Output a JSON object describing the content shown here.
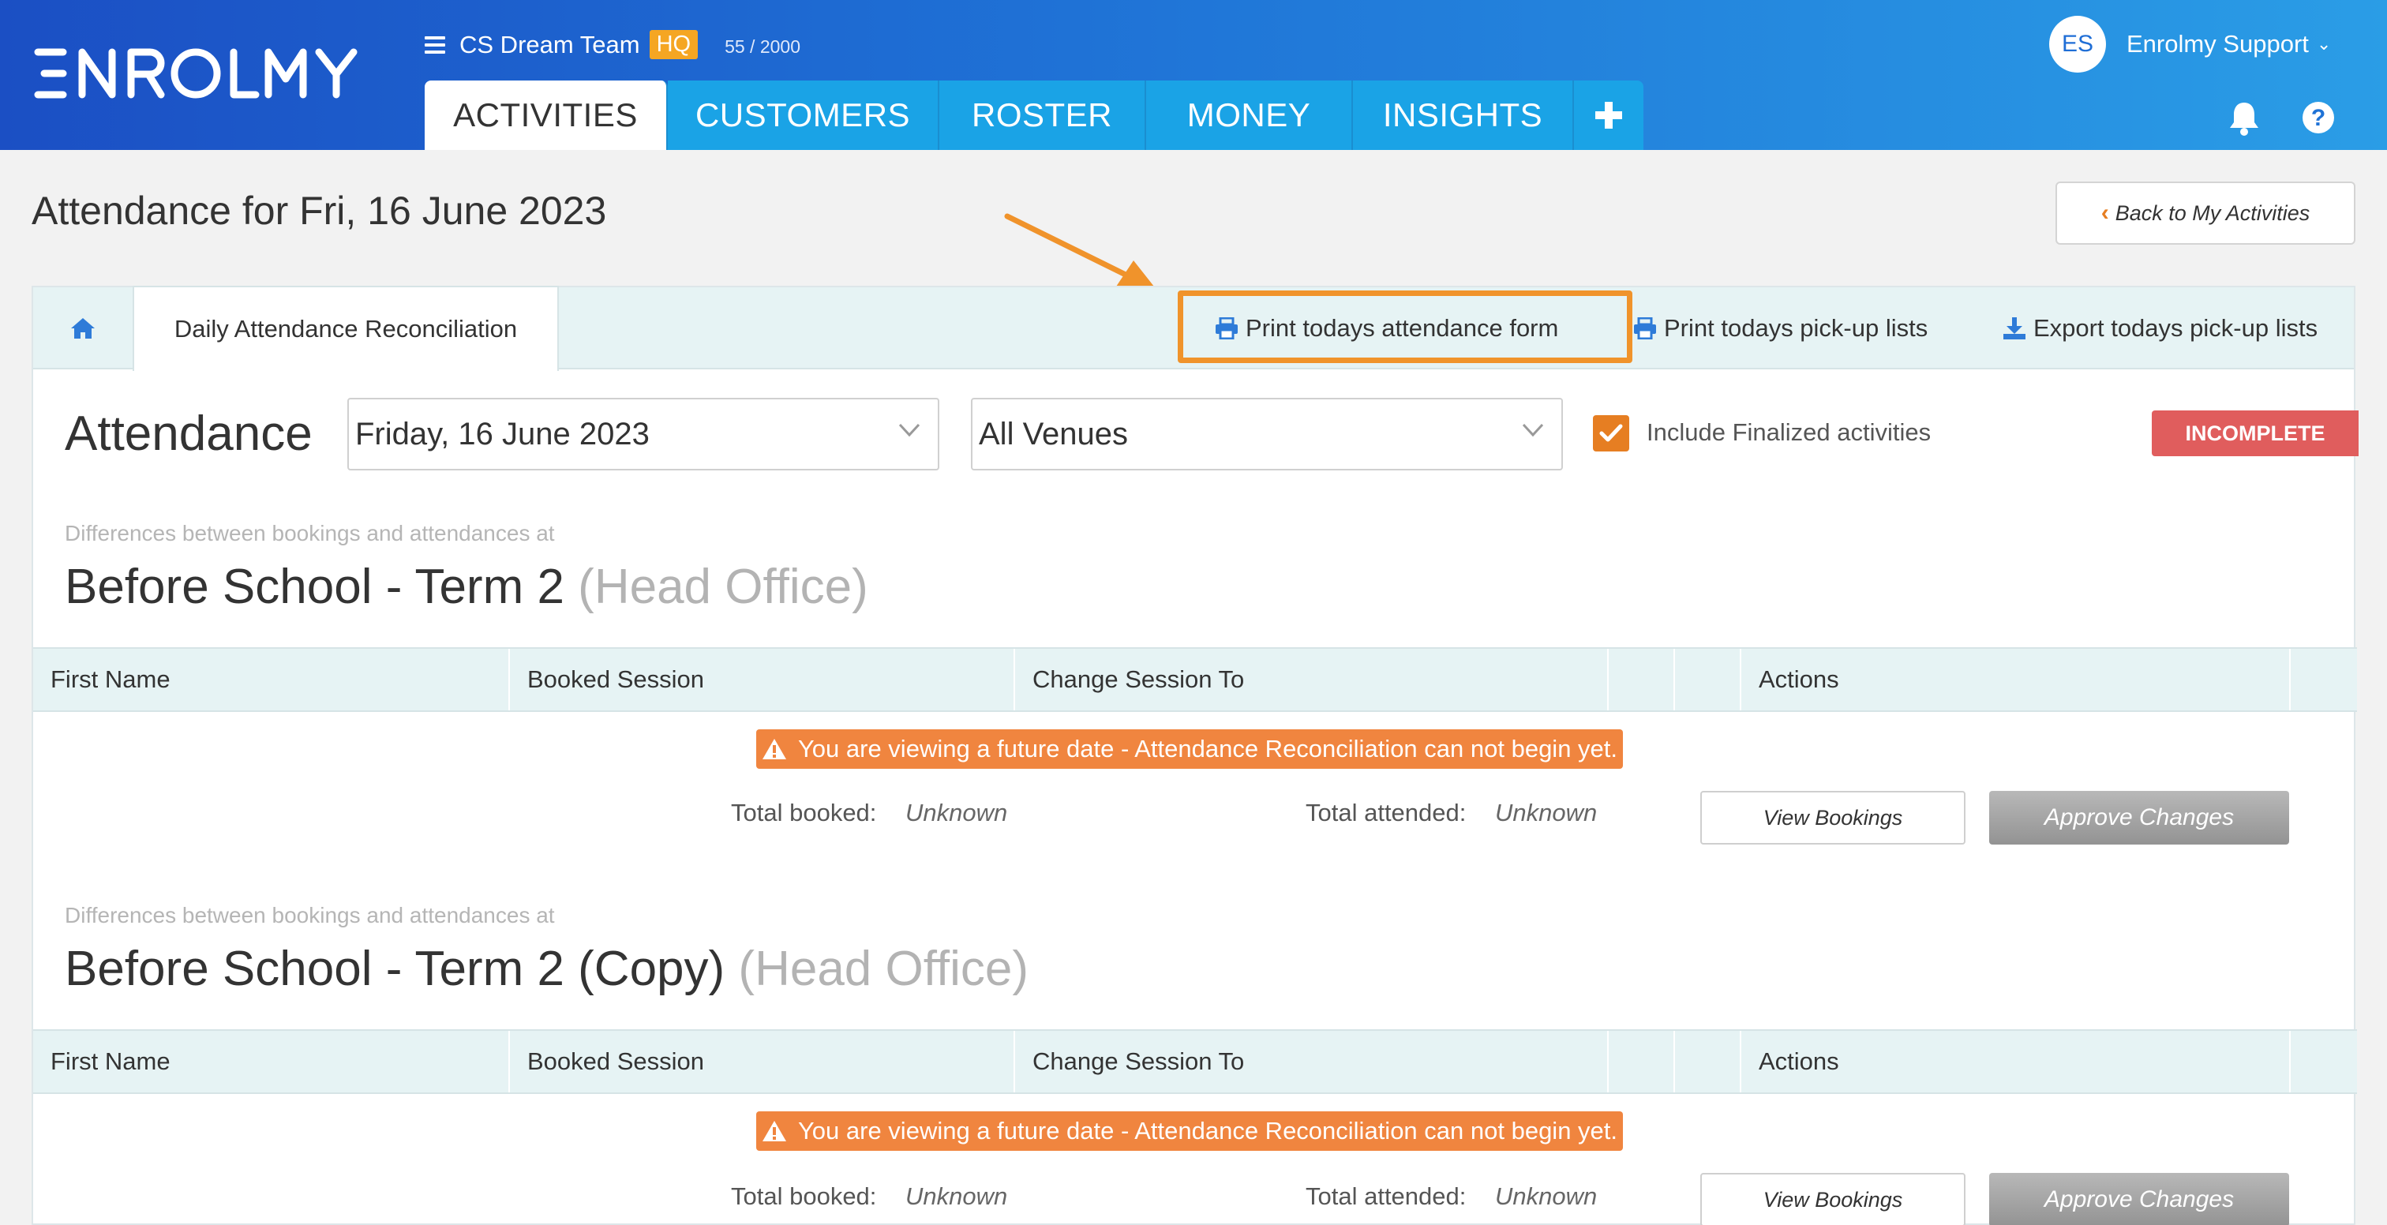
{
  "app": {
    "logo_text": "ENROLMY"
  },
  "team": {
    "name": "CS Dream Team",
    "badge": "HQ",
    "counter": "55 / 2000"
  },
  "nav": {
    "tabs": [
      {
        "label": "ACTIVITIES",
        "active": true
      },
      {
        "label": "CUSTOMERS"
      },
      {
        "label": "ROSTER"
      },
      {
        "label": "MONEY"
      },
      {
        "label": "INSIGHTS"
      }
    ],
    "add_icon": "plus-icon"
  },
  "user": {
    "initials": "ES",
    "name": "Enrolmy Support"
  },
  "page": {
    "title": "Attendance for Fri, 16 June 2023",
    "back_label": "Back to My Activities"
  },
  "subnav": {
    "tab_label": "Daily Attendance Reconciliation",
    "print_form": "Print todays attendance form",
    "print_pickup": "Print todays pick-up lists",
    "export_pickup": "Export todays pick-up lists"
  },
  "filters": {
    "heading": "Attendance",
    "date_value": "Friday, 16 June 2023",
    "venue_value": "All Venues",
    "include_finalized_label": "Include Finalized activities",
    "include_finalized_checked": true,
    "status_badge": "INCOMPLETE"
  },
  "sections": [
    {
      "subtitle": "Differences between bookings and attendances at",
      "title": "Before School - Term 2",
      "location": "(Head Office)",
      "columns": [
        "First Name",
        "Booked Session",
        "Change Session To",
        "",
        "",
        "Actions"
      ],
      "warning": "You are viewing a future date - Attendance Reconciliation can not begin yet.",
      "total_booked_label": "Total booked:",
      "total_booked_value": "Unknown",
      "total_attended_label": "Total attended:",
      "total_attended_value": "Unknown",
      "view_bookings": "View Bookings",
      "approve_changes": "Approve Changes"
    },
    {
      "subtitle": "Differences between bookings and attendances at",
      "title": "Before School - Term 2 (Copy)",
      "location": "(Head Office)",
      "columns": [
        "First Name",
        "Booked Session",
        "Change Session To",
        "",
        "",
        "Actions"
      ],
      "warning": "You are viewing a future date - Attendance Reconciliation can not begin yet.",
      "total_booked_label": "Total booked:",
      "total_booked_value": "Unknown",
      "total_attended_label": "Total attended:",
      "total_attended_value": "Unknown",
      "view_bookings": "View Bookings",
      "approve_changes": "Approve Changes"
    }
  ],
  "colors": {
    "brand_blue": "#1f6ed6",
    "tab_blue": "#1aa3e6",
    "accent_orange": "#f0932b",
    "danger_red": "#e05d5d"
  }
}
